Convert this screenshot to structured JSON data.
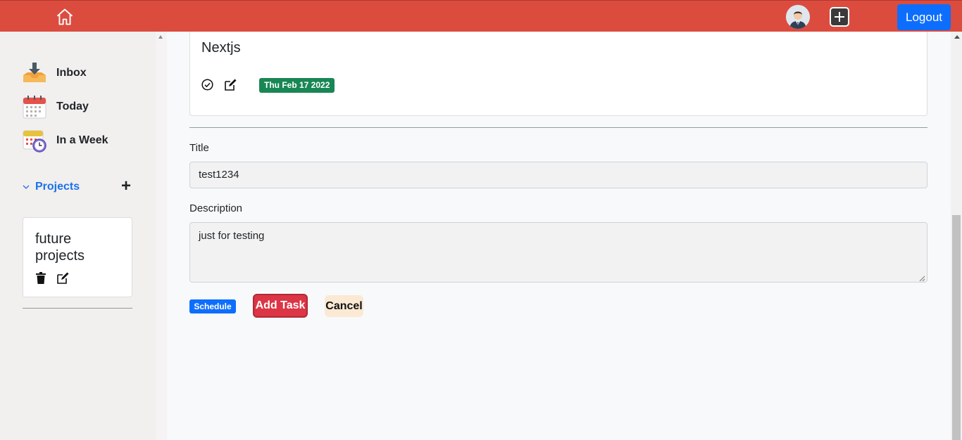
{
  "topbar": {
    "home_icon": "home-icon",
    "avatar_icon": "user-avatar",
    "add_icon": "plus-square-icon",
    "logout_label": "Logout",
    "bg_color": "#db4c3f"
  },
  "sidebar": {
    "items": [
      {
        "label": "Inbox",
        "icon": "inbox-tray-icon"
      },
      {
        "label": "Today",
        "icon": "calendar-icon"
      },
      {
        "label": "In a Week",
        "icon": "calendar-clock-icon"
      }
    ],
    "projects_label": "Projects",
    "projects_add": "+",
    "projects": [
      {
        "name": "future projects"
      }
    ]
  },
  "task": {
    "title": "Nextjs",
    "date": "Thu Feb 17 2022"
  },
  "form": {
    "title_label": "Title",
    "title_value": "test1234",
    "description_label": "Description",
    "description_value": "just for testing",
    "schedule_label": "Schedule",
    "add_task_label": "Add Task",
    "cancel_label": "Cancel"
  }
}
